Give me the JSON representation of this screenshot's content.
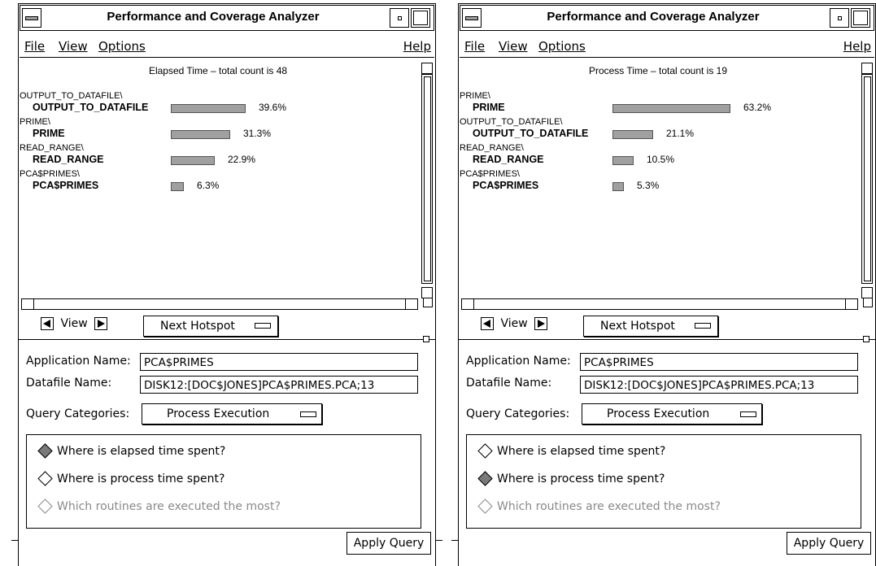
{
  "windows": [
    {
      "title": "Performance and Coverage Analyzer",
      "menu": {
        "file": "File",
        "view": "View",
        "options": "Options",
        "help": "Help"
      },
      "graph": {
        "header": "Elapsed Time – total count is 48",
        "rows": [
          {
            "parent": "OUTPUT_TO_DATAFILE\\",
            "label": "OUTPUT_TO_DATAFILE",
            "pct_text": "39.6%",
            "pct": 39.6
          },
          {
            "parent": "PRIME\\",
            "label": "PRIME",
            "pct_text": "31.3%",
            "pct": 31.3
          },
          {
            "parent": "READ_RANGE\\",
            "label": "READ_RANGE",
            "pct_text": "22.9%",
            "pct": 22.9
          },
          {
            "parent": "PCA$PRIMES\\",
            "label": "PCA$PRIMES",
            "pct_text": "6.3%",
            "pct": 6.3
          }
        ]
      },
      "nav": {
        "view_label": "View",
        "next_hotspot": "Next Hotspot"
      },
      "form": {
        "app_name_label": "Application Name:",
        "app_name_value": "PCA$PRIMES",
        "datafile_label": "Datafile Name:",
        "datafile_value": "DISK12:[DOC$JONES]PCA$PRIMES.PCA;13",
        "query_label": "Query Categories:",
        "query_value": "Process Execution"
      },
      "radios": [
        {
          "label": "Where is elapsed time spent?",
          "selected": true,
          "disabled": false
        },
        {
          "label": "Where is process time spent?",
          "selected": false,
          "disabled": false
        },
        {
          "label": "Which routines are executed the most?",
          "selected": false,
          "disabled": true
        }
      ],
      "apply": "Apply Query"
    },
    {
      "title": "Performance and Coverage Analyzer",
      "menu": {
        "file": "File",
        "view": "View",
        "options": "Options",
        "help": "Help"
      },
      "graph": {
        "header": "Process Time – total count is 19",
        "rows": [
          {
            "parent": "PRIME\\",
            "label": "PRIME",
            "pct_text": "63.2%",
            "pct": 63.2
          },
          {
            "parent": "OUTPUT_TO_DATAFILE\\",
            "label": "OUTPUT_TO_DATAFILE",
            "pct_text": "21.1%",
            "pct": 21.1
          },
          {
            "parent": "READ_RANGE\\",
            "label": "READ_RANGE",
            "pct_text": "10.5%",
            "pct": 10.5
          },
          {
            "parent": "PCA$PRIMES\\",
            "label": "PCA$PRIMES",
            "pct_text": "5.3%",
            "pct": 5.3
          }
        ]
      },
      "nav": {
        "view_label": "View",
        "next_hotspot": "Next Hotspot"
      },
      "form": {
        "app_name_label": "Application Name:",
        "app_name_value": "PCA$PRIMES",
        "datafile_label": "Datafile Name:",
        "datafile_value": "DISK12:[DOC$JONES]PCA$PRIMES.PCA;13",
        "query_label": "Query Categories:",
        "query_value": "Process Execution"
      },
      "radios": [
        {
          "label": "Where is elapsed time spent?",
          "selected": false,
          "disabled": false
        },
        {
          "label": "Where is process time spent?",
          "selected": true,
          "disabled": false
        },
        {
          "label": "Which routines are executed the most?",
          "selected": false,
          "disabled": true
        }
      ],
      "apply": "Apply Query"
    }
  ]
}
